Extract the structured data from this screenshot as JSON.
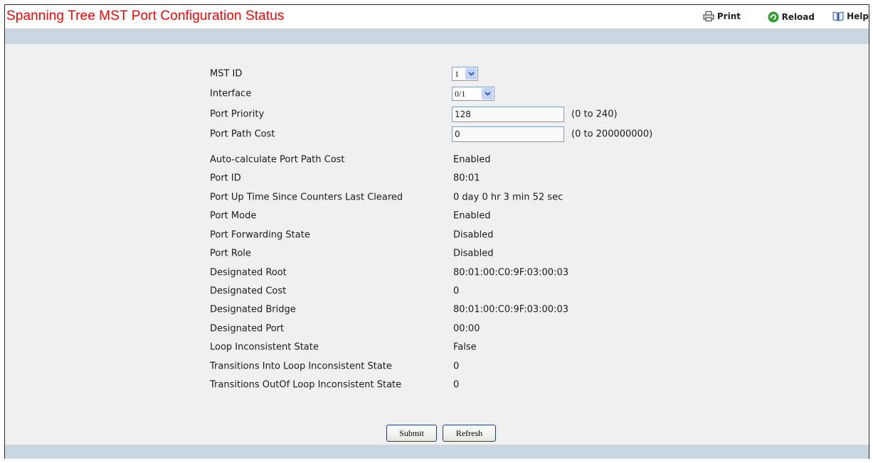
{
  "header": {
    "title": "Spanning Tree MST Port Configuration Status",
    "print_label": "Print",
    "reload_label": "Reload",
    "help_label": "Help"
  },
  "form": {
    "mst_id": {
      "label": "MST ID",
      "value": "1"
    },
    "interface": {
      "label": "Interface",
      "value": "0/1"
    },
    "port_priority": {
      "label": "Port Priority",
      "value": "128",
      "range": "(0 to 240)"
    },
    "port_path_cost": {
      "label": "Port Path Cost",
      "value": "0",
      "range": "(0 to 200000000)"
    },
    "fields": [
      {
        "label": "Auto-calculate Port Path Cost",
        "value": "Enabled"
      },
      {
        "label": "Port ID",
        "value": "80:01"
      },
      {
        "label": "Port Up Time Since Counters Last Cleared",
        "value": "0 day 0 hr 3 min 52 sec"
      },
      {
        "label": "Port Mode",
        "value": "Enabled"
      },
      {
        "label": "Port Forwarding State",
        "value": "Disabled"
      },
      {
        "label": "Port Role",
        "value": "Disabled"
      },
      {
        "label": "Designated Root",
        "value": "80:01:00:C0:9F:03:00:03"
      },
      {
        "label": "Designated Cost",
        "value": "0"
      },
      {
        "label": "Designated Bridge",
        "value": "80:01:00:C0:9F:03:00:03"
      },
      {
        "label": "Designated Port",
        "value": "00:00"
      },
      {
        "label": "Loop Inconsistent State",
        "value": "False"
      },
      {
        "label": "Transitions Into Loop Inconsistent State",
        "value": "0"
      },
      {
        "label": "Transitions OutOf Loop Inconsistent State",
        "value": "0"
      }
    ]
  },
  "buttons": {
    "submit_label": "Submit",
    "refresh_label": "Refresh"
  },
  "colors": {
    "title": "#ff0000",
    "bar": "#cad7e1",
    "background": "#f0f0f0"
  },
  "icons": [
    "printer-icon",
    "reload-icon",
    "help-book-icon",
    "chevron-down-icon"
  ]
}
